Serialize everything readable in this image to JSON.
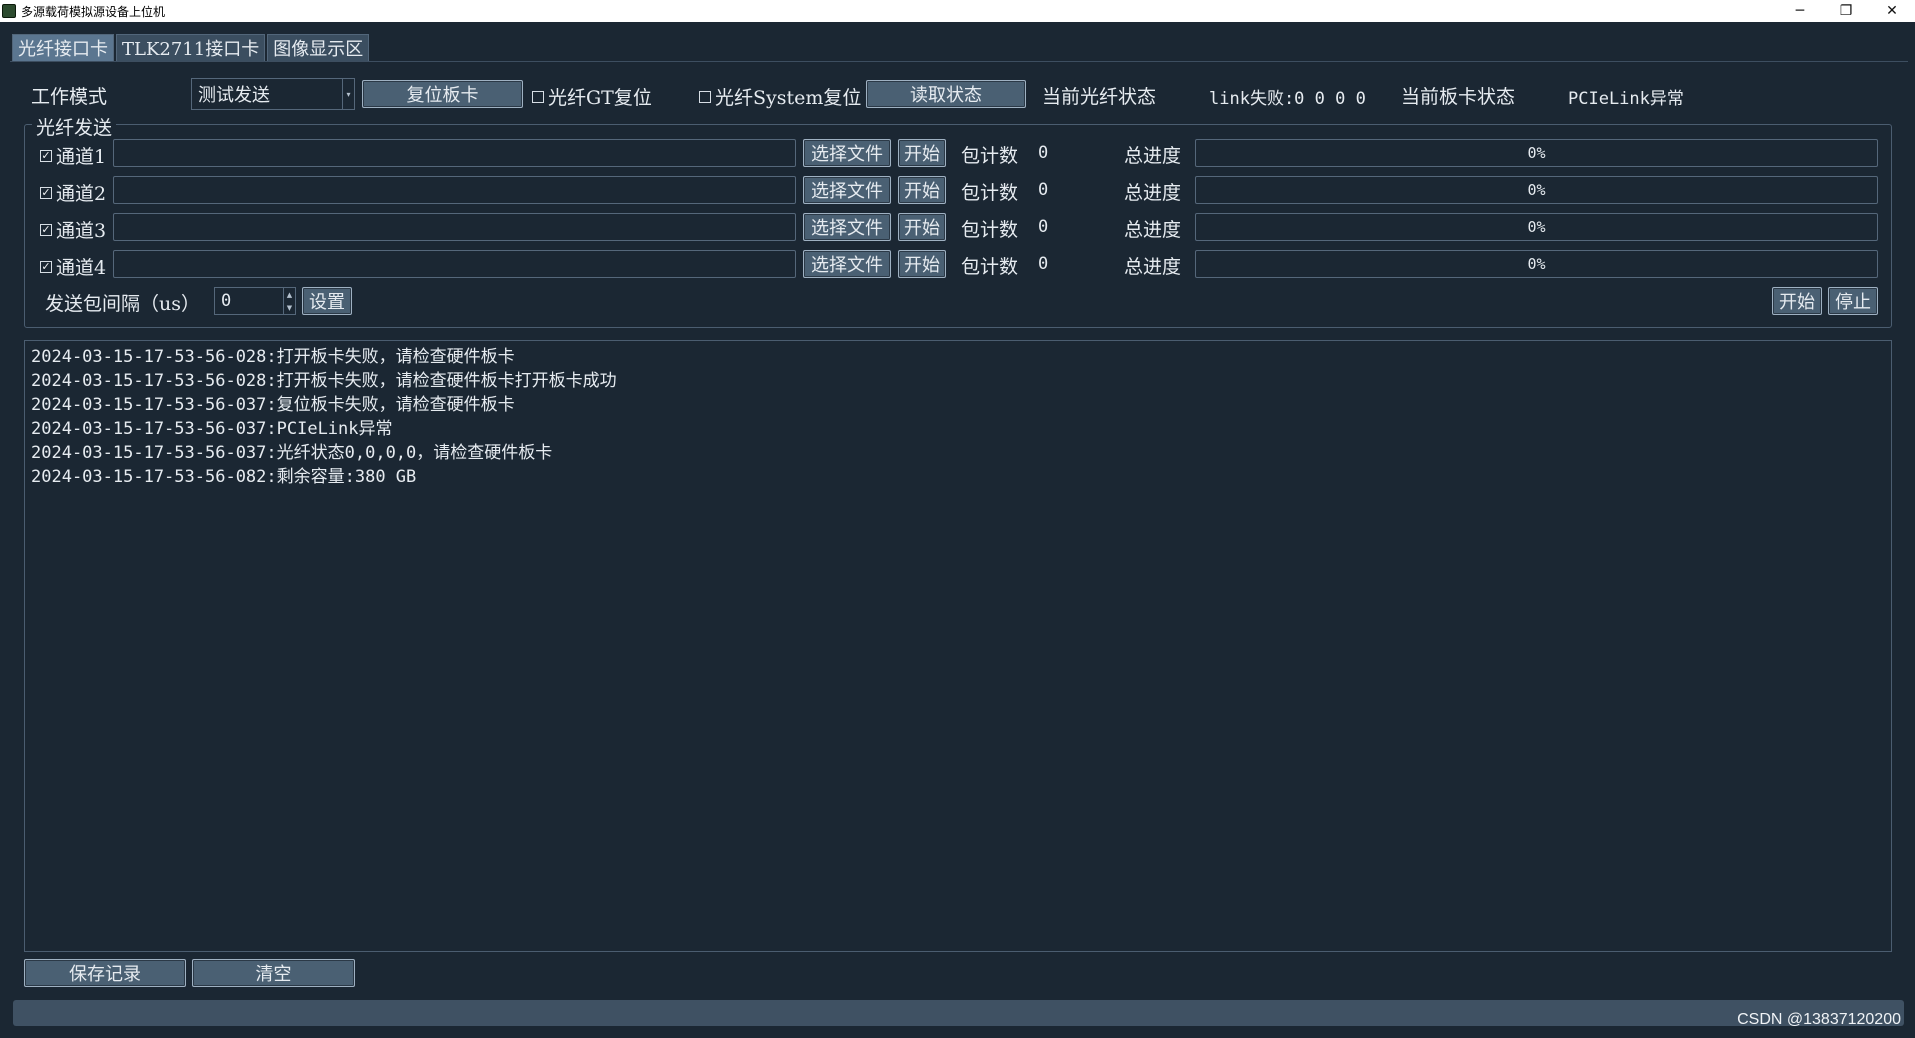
{
  "window": {
    "title": "多源载荷模拟源设备上位机",
    "minimize": "─",
    "restore": "❐",
    "close": "✕"
  },
  "tabs": [
    "光纤接口卡",
    "TLK2711接口卡",
    "图像显示区"
  ],
  "top": {
    "mode_label": "工作模式",
    "mode_value": "测试发送",
    "reset_card_button": "复位板卡",
    "gt_reset_label": "光纤GT复位",
    "system_reset_label": "光纤System复位",
    "read_status_button": "读取状态",
    "fiber_status_label": "当前光纤状态",
    "link_fail_text": "link失败:0 0 0 0",
    "card_status_label": "当前板卡状态",
    "card_status_value": "PCIeLink异常"
  },
  "send_group": {
    "title": "光纤发送",
    "channels": [
      {
        "name": "通道1",
        "checked": true,
        "select_label": "选择文件",
        "start_label": "开始",
        "count_label": "包计数",
        "count": "0",
        "progress_label": "总进度",
        "progress": "0%"
      },
      {
        "name": "通道2",
        "checked": true,
        "select_label": "选择文件",
        "start_label": "开始",
        "count_label": "包计数",
        "count": "0",
        "progress_label": "总进度",
        "progress": "0%"
      },
      {
        "name": "通道3",
        "checked": true,
        "select_label": "选择文件",
        "start_label": "开始",
        "count_label": "包计数",
        "count": "0",
        "progress_label": "总进度",
        "progress": "0%"
      },
      {
        "name": "通道4",
        "checked": true,
        "select_label": "选择文件",
        "start_label": "开始",
        "count_label": "包计数",
        "count": "0",
        "progress_label": "总进度",
        "progress": "0%"
      }
    ],
    "interval_label": "发送包间隔（us）",
    "interval_value": "0",
    "set_button": "设置",
    "start_all_button": "开始",
    "stop_all_button": "停止"
  },
  "log": [
    "2024-03-15-17-53-56-028:打开板卡失败，请检查硬件板卡",
    "2024-03-15-17-53-56-028:打开板卡失败，请检查硬件板卡打开板卡成功",
    "2024-03-15-17-53-56-037:复位板卡失败，请检查硬件板卡",
    "2024-03-15-17-53-56-037:PCIeLink异常",
    "2024-03-15-17-53-56-037:光纤状态0,0,0,0，请检查硬件板卡",
    "2024-03-15-17-53-56-082:剩余容量:380 GB"
  ],
  "bottom": {
    "save_button": "保存记录",
    "clear_button": "清空"
  },
  "watermark": "CSDN @13837120200"
}
